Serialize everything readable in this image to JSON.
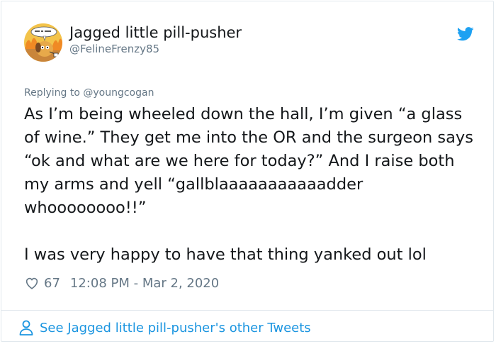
{
  "author": {
    "display_name": "Jagged little pill-pusher",
    "handle": "@FelineFrenzy85",
    "avatar_sign_text": "THIS IS FINE",
    "avatar_icon": "this-is-fine-dog-avatar"
  },
  "brand_icon": "twitter-bird-icon",
  "reply_context": "Replying to @youngcogan",
  "tweet": {
    "paragraphs": [
      "As I’m being wheeled down the hall, I’m given “a glass of wine.” They get me into the OR and the surgeon says “ok and what are we here for today?” And I raise both my arms and yell “gallblaaaaaaaaaaadder whoooooooo!!”",
      "I was very happy to have that thing yanked out lol"
    ]
  },
  "meta": {
    "like_icon": "heart-icon",
    "likes": "67",
    "timestamp": "12:08 PM - Mar 2, 2020"
  },
  "footer": {
    "icon": "person-icon",
    "link_text": "See Jagged little pill-pusher's other Tweets"
  },
  "colors": {
    "link": "#1b95e0",
    "secondary_text": "#657786",
    "twitter_blue": "#1da1f2",
    "border": "#e1e8ed"
  }
}
